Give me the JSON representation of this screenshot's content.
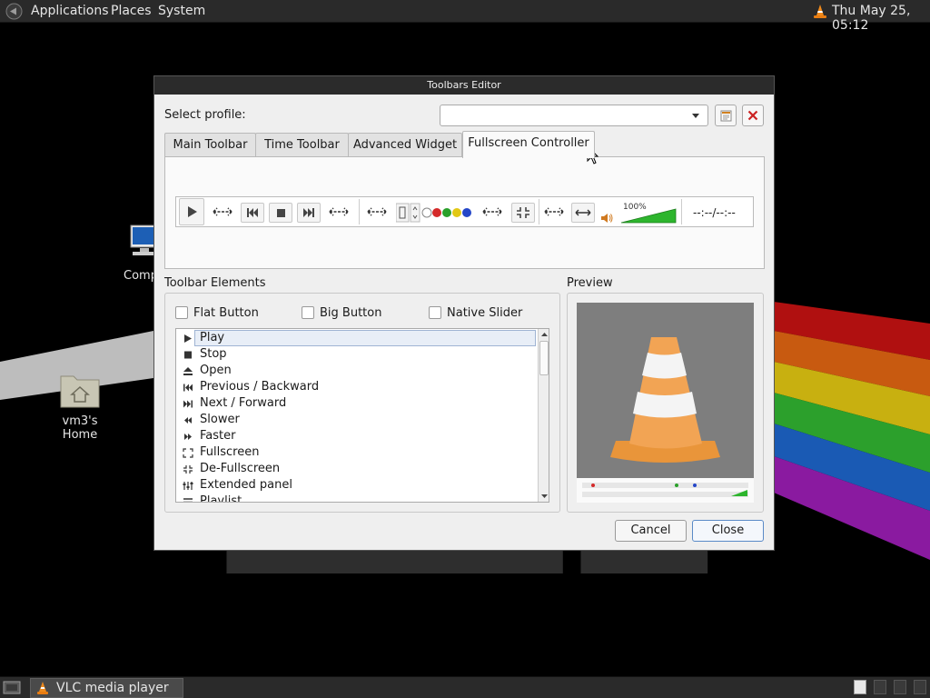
{
  "top_panel": {
    "menus": [
      "Applications",
      "Places",
      "System"
    ],
    "clock": "Thu May 25, 05:12"
  },
  "desktop": {
    "icons": [
      {
        "label": "Comp"
      },
      {
        "label": "vm3's Home"
      }
    ]
  },
  "dialog": {
    "title": "Toolbars Editor",
    "select_profile_label": "Select profile:",
    "profile_value": "",
    "tabs": [
      "Main Toolbar",
      "Time Toolbar",
      "Advanced Widget",
      "Fullscreen Controller"
    ],
    "active_tab": "Fullscreen Controller",
    "toolbar_preview": {
      "volume": "100%",
      "time": "--:--/--:--"
    },
    "toolbar_elements_label": "Toolbar Elements",
    "options": {
      "flat_button": "Flat Button",
      "big_button": "Big Button",
      "native_slider": "Native Slider"
    },
    "elements": [
      {
        "label": "Play",
        "icon": "play-icon"
      },
      {
        "label": "Stop",
        "icon": "stop-icon"
      },
      {
        "label": "Open",
        "icon": "eject-icon"
      },
      {
        "label": "Previous / Backward",
        "icon": "previous-icon"
      },
      {
        "label": "Next / Forward",
        "icon": "next-icon"
      },
      {
        "label": "Slower",
        "icon": "slower-icon"
      },
      {
        "label": "Faster",
        "icon": "faster-icon"
      },
      {
        "label": "Fullscreen",
        "icon": "fullscreen-icon"
      },
      {
        "label": "De-Fullscreen",
        "icon": "defullscreen-icon"
      },
      {
        "label": "Extended panel",
        "icon": "extended-panel-icon"
      },
      {
        "label": "Playlist",
        "icon": "playlist-icon"
      }
    ],
    "selected_element": "Play",
    "preview_label": "Preview",
    "buttons": {
      "cancel": "Cancel",
      "close": "Close"
    }
  },
  "taskbar": {
    "task_label": "VLC media player"
  },
  "colors": {
    "panel": "#2a2a2a",
    "dialog_bg": "#efefef",
    "accent": "#5a8ac7",
    "close_red": "#cc2222",
    "volume_green": "#2db52d"
  }
}
